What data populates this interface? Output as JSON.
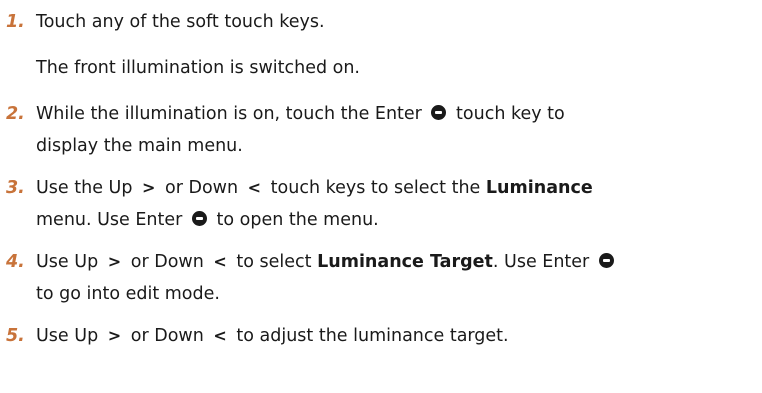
{
  "steps": [
    {
      "number": "1.",
      "text": "Touch any of the soft touch keys.",
      "result": "The front illumination is switched on."
    },
    {
      "number": "2.",
      "p1": "While the illumination is on, touch the Enter",
      "p2": "touch key to",
      "p3": "display the main menu."
    },
    {
      "number": "3.",
      "p1": "Use the Up",
      "p2": "or Down",
      "p3": "touch keys to select the",
      "bold": "Luminance",
      "p4": "menu. Use Enter",
      "p5": "to open the menu."
    },
    {
      "number": "4.",
      "p1": "Use Up",
      "p2": "or Down",
      "p3": "to select",
      "bold": "Luminance Target",
      "p4": ". Use Enter",
      "p5": "to go into edit mode."
    },
    {
      "number": "5.",
      "p1": "Use Up",
      "p2": "or Down",
      "p3": "to adjust the luminance target."
    }
  ],
  "icons": {
    "up": ">",
    "down": "<",
    "enter": "enter-key-icon"
  }
}
